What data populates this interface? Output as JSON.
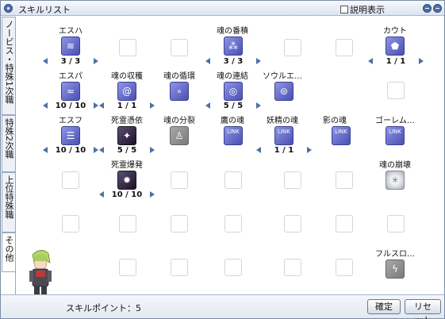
{
  "window": {
    "title": "スキルリスト",
    "desc_toggle": "説明表示"
  },
  "tabs": [
    "ノービス・特殊1次職",
    "特殊2次職",
    "上位特殊職",
    "その他"
  ],
  "skills": [
    {
      "name": "エスハ",
      "level": "3 / 3",
      "icon": "swirl-icon"
    },
    {
      "name": "魂の番積",
      "level": "3 / 3",
      "icon": "soul-stars-icon"
    },
    {
      "name": "カウト",
      "level": "1 / 1",
      "icon": "pentagon-icon"
    },
    {
      "name": "エスパ",
      "level": "10 / 10",
      "icon": "wave-icon"
    },
    {
      "name": "魂の収穫",
      "level": "1 / 1",
      "icon": "spiral-icon"
    },
    {
      "name": "魂の循環",
      "level": "",
      "icon": "orbit-icon"
    },
    {
      "name": "魂の連結",
      "level": "5 / 5",
      "icon": "soul-link-icon"
    },
    {
      "name": "ソウルエ…",
      "level": "",
      "icon": "disc-icon"
    },
    {
      "name": "エスフ",
      "level": "10 / 10",
      "icon": "layers-icon"
    },
    {
      "name": "死霊憑依",
      "level": "5 / 5",
      "icon": "dark-spirit-icon"
    },
    {
      "name": "魂の分裂",
      "level": "",
      "icon": "split-soul-icon"
    },
    {
      "name": "鷹の魂",
      "level": "",
      "icon": "hawk-link-icon"
    },
    {
      "name": "妖精の魂",
      "level": "1 / 1",
      "icon": "fairy-link-icon"
    },
    {
      "name": "影の魂",
      "level": "",
      "icon": "shadow-link-icon"
    },
    {
      "name": "ゴーレム…",
      "level": "",
      "icon": "golem-link-icon"
    },
    {
      "name": "死霊爆発",
      "level": "10 / 10",
      "icon": "necro-burst-icon"
    },
    {
      "name": "魂の崩壊",
      "level": "",
      "icon": "soul-burst-icon"
    },
    {
      "name": "フルスロ…",
      "level": "",
      "icon": "lightning-icon"
    }
  ],
  "link_label": "LINK",
  "bottom": {
    "skill_points": "スキルポイント：5",
    "confirm": "確定",
    "reset": "リセット"
  }
}
